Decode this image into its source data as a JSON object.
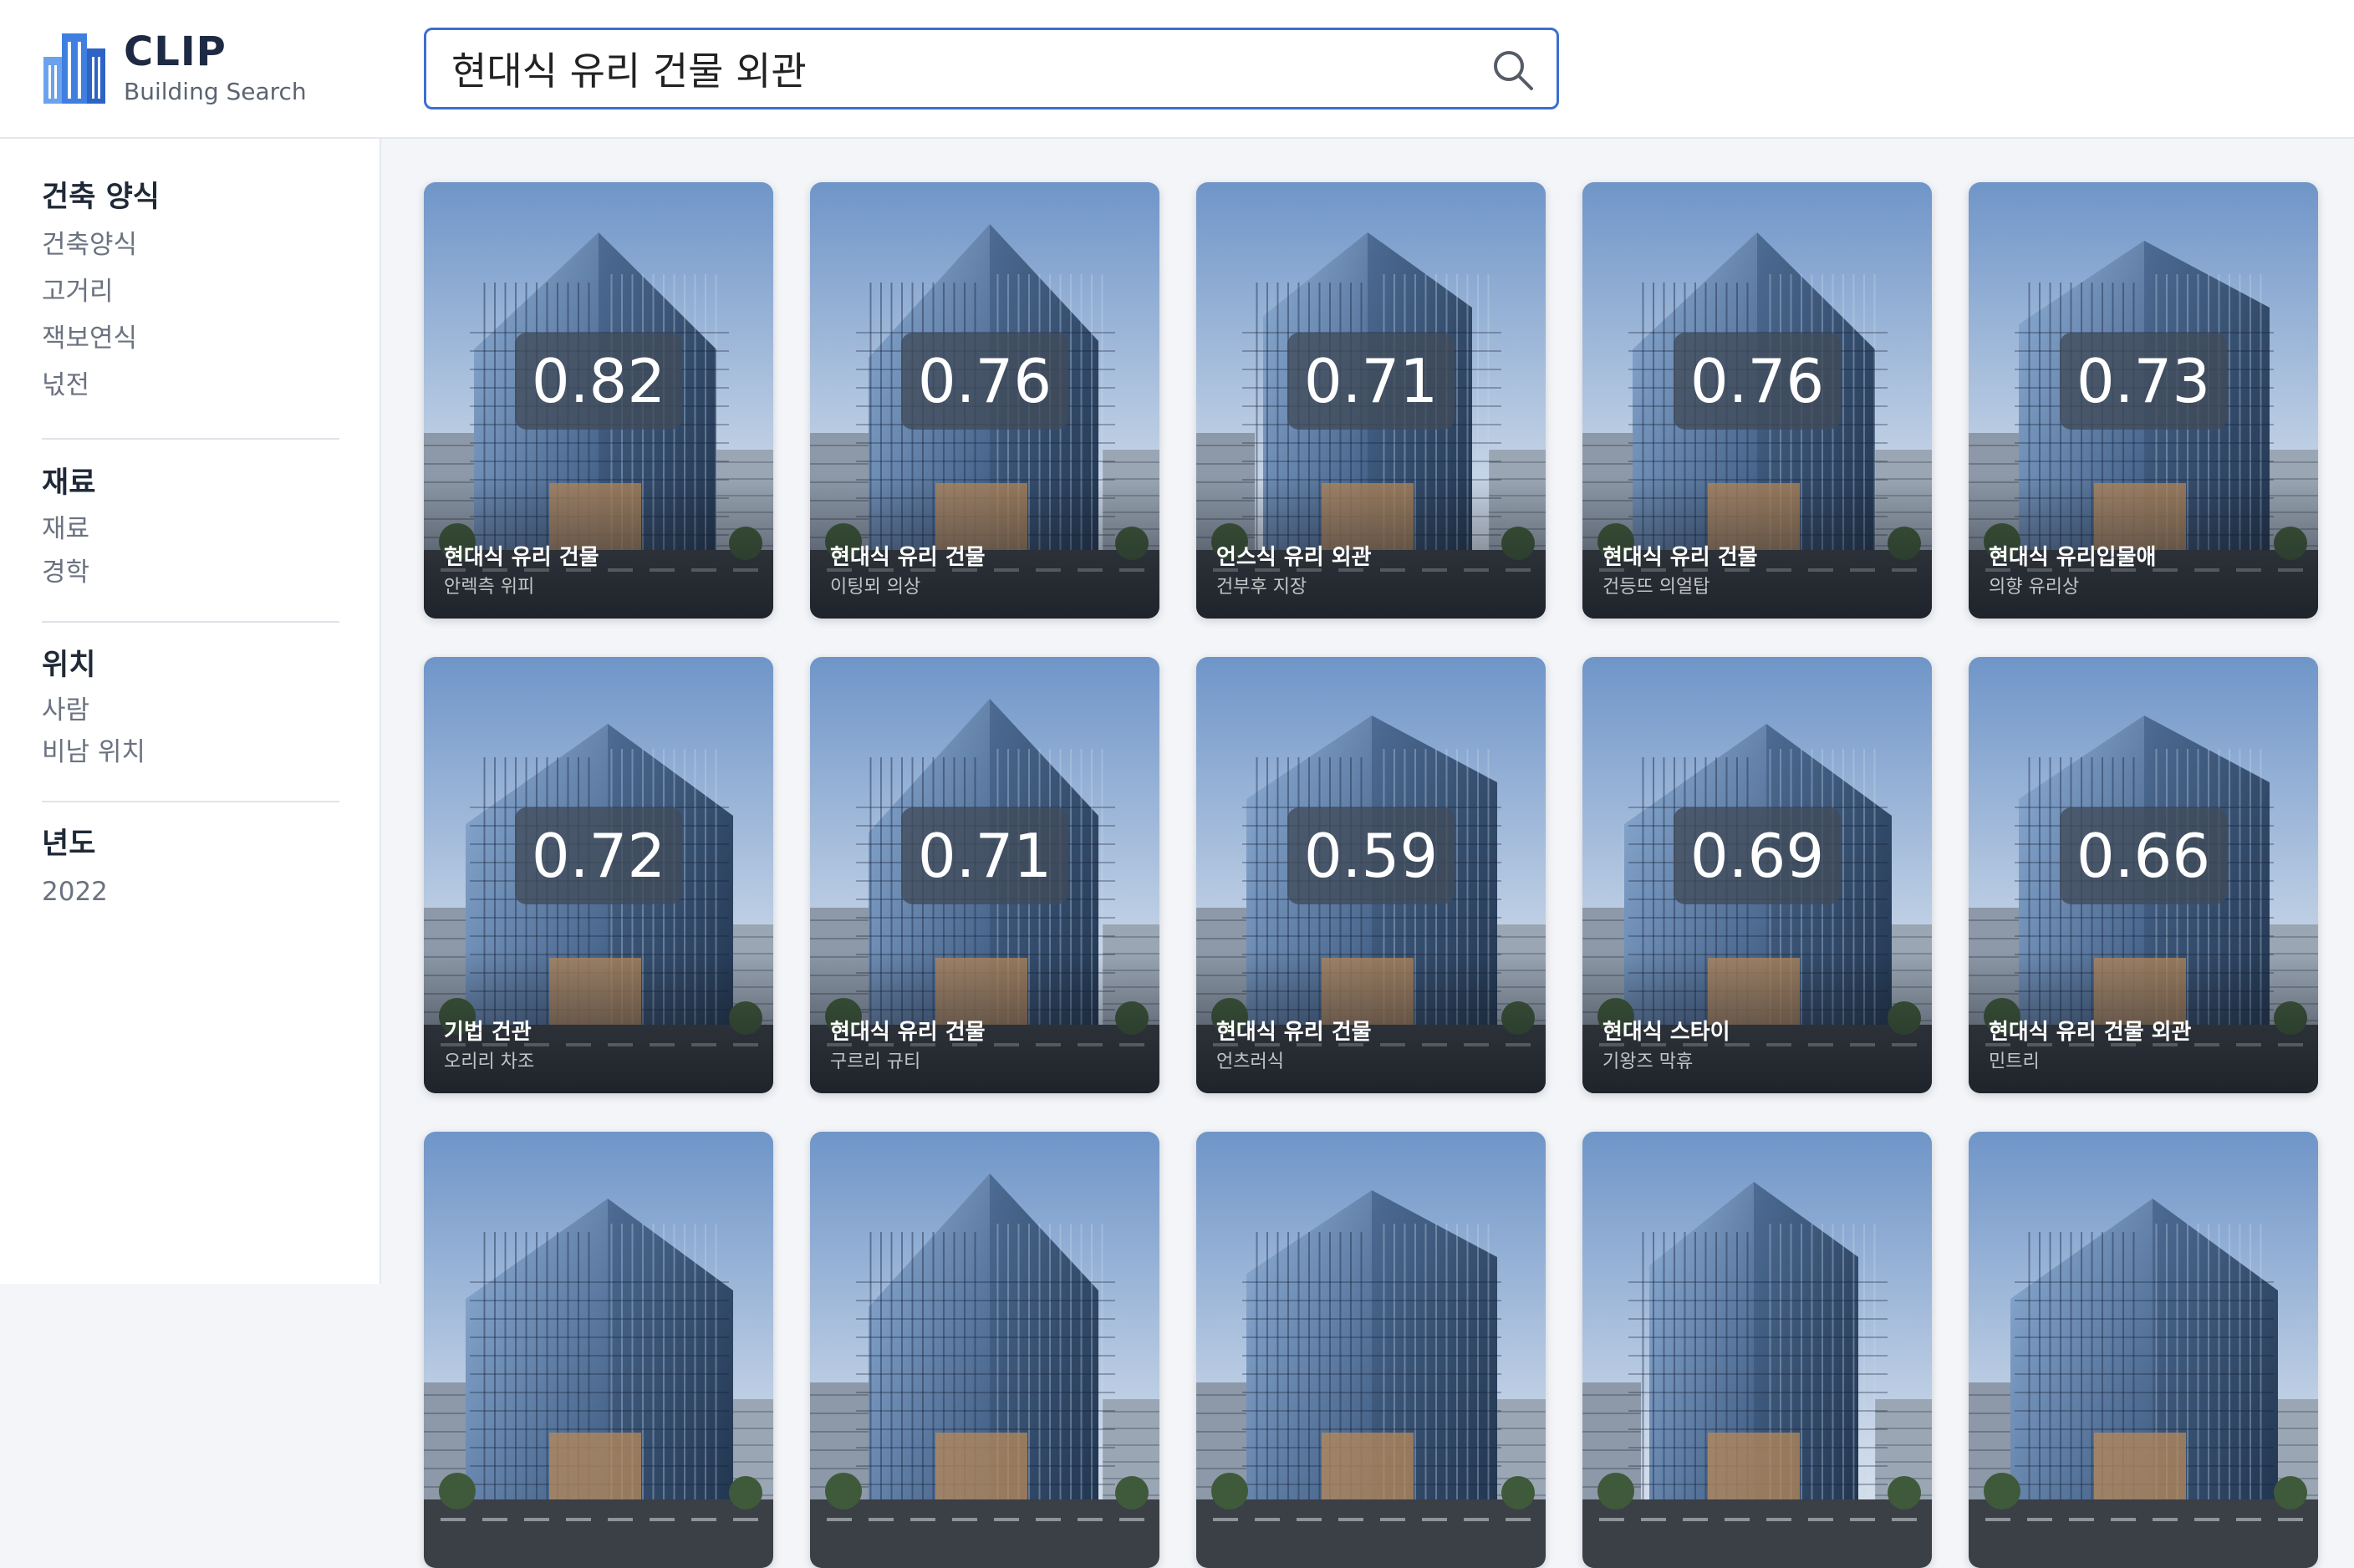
{
  "brand": {
    "title": "CLIP",
    "subtitle": "Building Search"
  },
  "search": {
    "value": "현대식 유리 건물 외관",
    "placeholder": ""
  },
  "facets": [
    {
      "title": "건축 양식",
      "items": [
        "건축양식",
        "고거리",
        "잭보연식",
        "넋전"
      ]
    },
    {
      "title": "재료",
      "items": [
        "재료",
        "경학"
      ]
    },
    {
      "title": "위치",
      "items": [
        "사람",
        "비남 위치"
      ]
    },
    {
      "title": "년도",
      "items": [
        "2022"
      ]
    }
  ],
  "results": [
    {
      "score": "0.82",
      "title": "현대식 유리 건물",
      "subtitle": "안렉측 위피",
      "variant": "tall"
    },
    {
      "score": "0.76",
      "title": "현대식 유리 건물",
      "subtitle": "이팅뫼 의상",
      "variant": "prism"
    },
    {
      "score": "0.71",
      "title": "언스식 유리 외관",
      "subtitle": "건부후 지장",
      "variant": "tower"
    },
    {
      "score": "0.76",
      "title": "현대식 유리 건물",
      "subtitle": "건등뜨 의얼탑",
      "variant": "tall"
    },
    {
      "score": "0.73",
      "title": "현대식 유리입물애",
      "subtitle": "의향 유리상",
      "variant": "block"
    },
    {
      "score": "0.72",
      "title": "기법 건관",
      "subtitle": "오리리 차조",
      "variant": "cube"
    },
    {
      "score": "0.71",
      "title": "현대식 유리 건물",
      "subtitle": "구르리 규티",
      "variant": "prism"
    },
    {
      "score": "0.59",
      "title": "현대식 유리 건물",
      "subtitle": "언츠러식",
      "variant": "block"
    },
    {
      "score": "0.69",
      "title": "현대식 스타이",
      "subtitle": "기왕즈 막휴",
      "variant": "cube"
    },
    {
      "score": "0.66",
      "title": "현대식 유리 건물 외관",
      "subtitle": "민트리",
      "variant": "block"
    },
    {
      "score": "",
      "title": "",
      "subtitle": "",
      "variant": "cube"
    },
    {
      "score": "",
      "title": "",
      "subtitle": "",
      "variant": "prism"
    },
    {
      "score": "",
      "title": "",
      "subtitle": "",
      "variant": "block"
    },
    {
      "score": "",
      "title": "",
      "subtitle": "",
      "variant": "tower"
    },
    {
      "score": "",
      "title": "",
      "subtitle": "",
      "variant": "cube"
    }
  ],
  "icons": {
    "logo": "building-logo-icon",
    "search": "search-icon"
  },
  "colors": {
    "accent": "#3b6fd0",
    "logo": "#3f7fe0",
    "brand_text": "#1e2a44"
  }
}
